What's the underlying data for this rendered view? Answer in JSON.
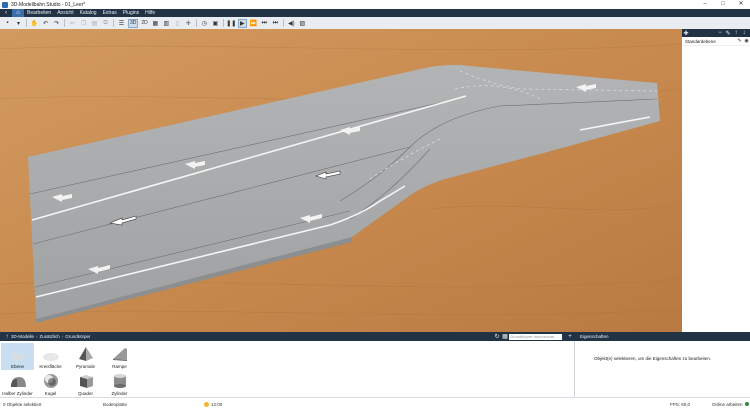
{
  "window": {
    "title": "3D-Modellbahn Studio - 01_Leer*",
    "controls": [
      "–",
      "□",
      "✕"
    ]
  },
  "menu": [
    "Bearbeiten",
    "Ansicht",
    "Katalog",
    "Extras",
    "Plugins",
    "Hilfe"
  ],
  "toolbar": {
    "view_3d": "3D",
    "view_2d": "2D"
  },
  "layers": {
    "default_layer": "Standardebene"
  },
  "catalog": {
    "breadcrumb": [
      "3D-Modelle",
      "Zusätzlich",
      "Grundkörper"
    ],
    "search_placeholder": "Grundkörper durchsuche...",
    "items": [
      {
        "label": "Ebene",
        "icon": "plane-icon"
      },
      {
        "label": "Kreisfläche",
        "icon": "disc-icon"
      },
      {
        "label": "Pyramide",
        "icon": "pyramid-icon"
      },
      {
        "label": "Rampe",
        "icon": "ramp-icon"
      },
      {
        "label": "Halber Zylinder",
        "icon": "half-cylinder-icon"
      },
      {
        "label": "Kugel",
        "icon": "sphere-icon"
      },
      {
        "label": "Quader",
        "icon": "cuboid-icon"
      },
      {
        "label": "Zylinder",
        "icon": "cylinder-icon"
      }
    ]
  },
  "properties": {
    "title": "Eigenschaften",
    "message": "Objekt(e) selektieren, um die Eigenschaften zu bearbeiten."
  },
  "status": {
    "selection": "0 Objekte selektiert",
    "ground": "Bodenplatte",
    "time": "12:00",
    "fps": "FPS: 60,0",
    "online": "Online arbeiten"
  },
  "colors": {
    "accent": "#213345",
    "selection": "#c9def0",
    "wood": "#c88d52",
    "road": "#a9abac"
  }
}
